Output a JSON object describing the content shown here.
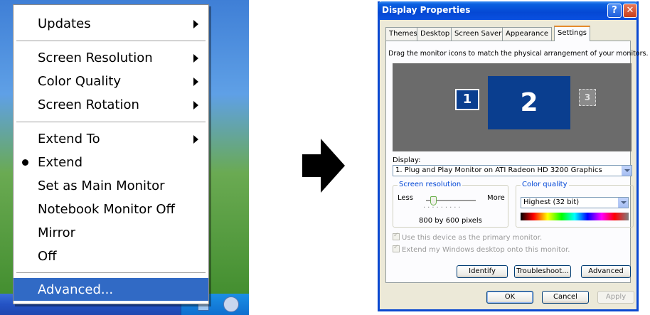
{
  "context_menu": {
    "items": [
      {
        "label": "Updates",
        "submenu": true
      },
      {
        "label": "Screen Resolution",
        "submenu": true
      },
      {
        "label": "Color Quality",
        "submenu": true
      },
      {
        "label": "Screen Rotation",
        "submenu": true
      },
      {
        "label": "Extend To",
        "submenu": true
      },
      {
        "label": "Extend",
        "checked": true
      },
      {
        "label": "Set as Main Monitor"
      },
      {
        "label": "Notebook Monitor Off"
      },
      {
        "label": "Mirror"
      },
      {
        "label": "Off"
      },
      {
        "label": "Advanced...",
        "highlighted": true
      }
    ]
  },
  "dialog": {
    "title": "Display Properties",
    "help_glyph": "?",
    "close_glyph": "✕",
    "tabs": [
      "Themes",
      "Desktop",
      "Screen Saver",
      "Appearance",
      "Settings"
    ],
    "active_tab": "Settings",
    "instruction": "Drag the monitor icons to match the physical arrangement of your monitors.",
    "monitors": [
      "1",
      "2",
      "3"
    ],
    "display_label": "Display:",
    "display_value": "1. Plug and Play Monitor on ATI Radeon HD 3200 Graphics",
    "resolution": {
      "group_title": "Screen resolution",
      "less": "Less",
      "more": "More",
      "value": "800 by 600 pixels",
      "slider_level": 0.1
    },
    "color_quality": {
      "group_title": "Color quality",
      "value": "Highest (32 bit)"
    },
    "checkboxes": [
      "Use this device as the primary monitor.",
      "Extend my Windows desktop onto this monitor."
    ],
    "buttons": {
      "identify": "Identify",
      "troubleshoot": "Troubleshoot...",
      "advanced": "Advanced",
      "ok": "OK",
      "cancel": "Cancel",
      "apply": "Apply"
    }
  },
  "colors": {
    "highlight": "#316ac5",
    "titlebar": "#0548d4",
    "dialog_bg": "#ece9d8",
    "monitor_blue": "#0a3e8f"
  }
}
